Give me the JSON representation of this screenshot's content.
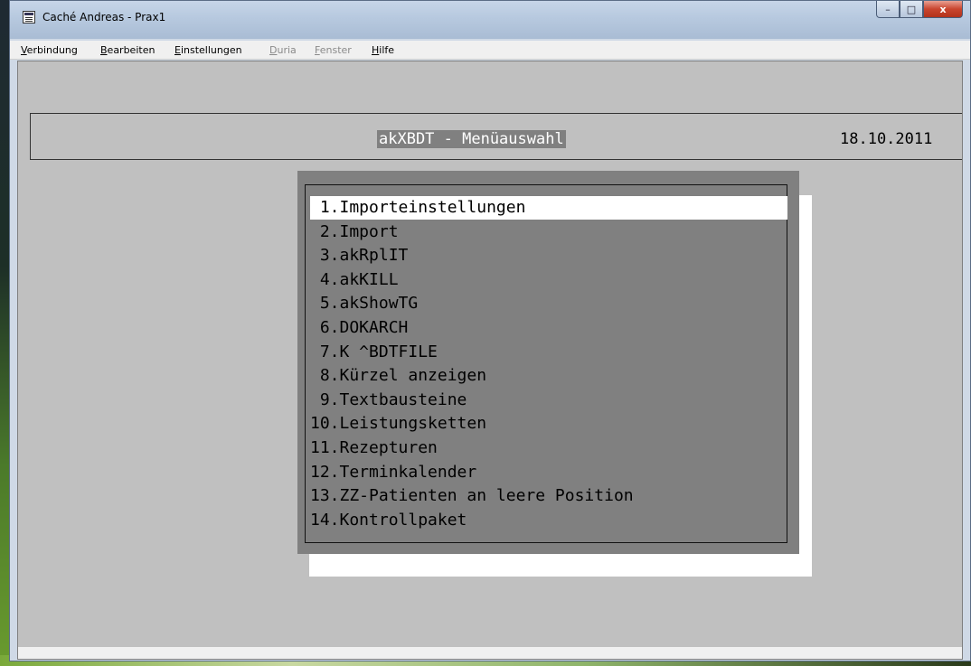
{
  "window": {
    "title": "Caché Andreas - Prax1",
    "controls": {
      "minimize": "–",
      "maximize": "□",
      "close": "x"
    }
  },
  "menubar": {
    "items": [
      {
        "label_u": "V",
        "label_rest": "erbindung",
        "enabled": true
      },
      {
        "label_u": "B",
        "label_rest": "earbeiten",
        "enabled": true
      },
      {
        "label_u": "E",
        "label_rest": "instellungen",
        "enabled": true
      },
      {
        "label_u": "D",
        "label_rest": "uria",
        "enabled": false
      },
      {
        "label_u": "F",
        "label_rest": "enster",
        "enabled": false
      },
      {
        "label_u": "H",
        "label_rest": "ilfe",
        "enabled": true
      }
    ]
  },
  "terminal": {
    "header_title": "akXBDT - Menüauswahl",
    "header_date": "18.10.2011",
    "selected_index": 0,
    "menu": [
      " 1.Importeinstellungen",
      " 2.Import",
      " 3.akRplIT",
      " 4.akKILL",
      " 5.akShowTG",
      " 6.DOKARCH",
      " 7.K ^BDTFILE",
      " 8.Kürzel anzeigen",
      " 9.Textbausteine",
      "10.Leistungsketten",
      "11.Rezepturen",
      "12.Terminkalender",
      "13.ZZ-Patienten an leere Position",
      "14.Kontrollpaket"
    ]
  },
  "colors": {
    "terminal_bg": "#c0c0c0",
    "panel_bg": "#808080",
    "highlight": "#ffffff"
  }
}
